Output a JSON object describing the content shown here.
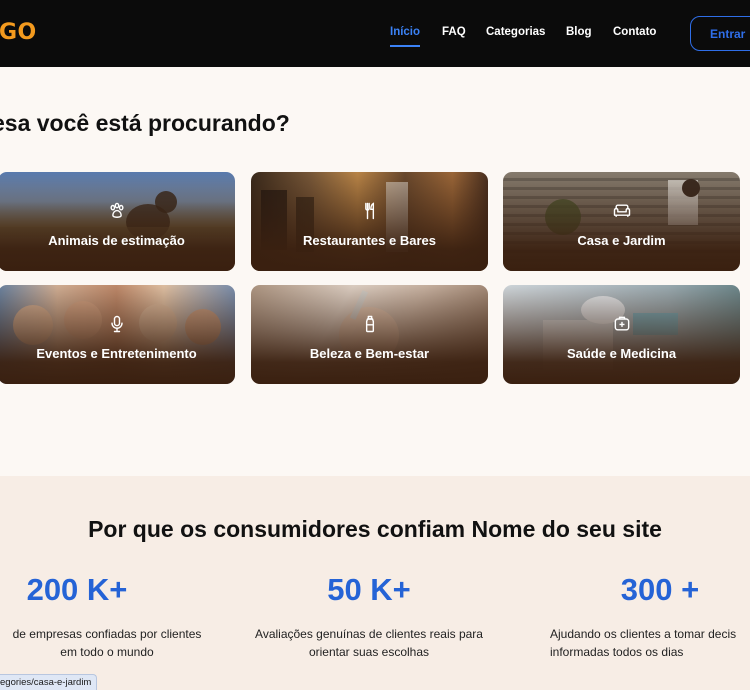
{
  "header": {
    "logo": "GO",
    "nav": [
      {
        "label": "Início",
        "active": true
      },
      {
        "label": "FAQ"
      },
      {
        "label": "Categorias"
      },
      {
        "label": "Blog"
      },
      {
        "label": "Contato"
      }
    ],
    "login_label": "Entrar",
    "accent_color": "#3b82f6",
    "logo_color": "#f39a1e"
  },
  "categories": {
    "title": "esa você está procurando?",
    "items": [
      {
        "label": "Animais de estimação",
        "icon": "paw-icon"
      },
      {
        "label": "Restaurantes e Bares",
        "icon": "fork-knife-icon"
      },
      {
        "label": "Casa e Jardim",
        "icon": "sofa-icon"
      },
      {
        "label": "Eventos e Entretenimento",
        "icon": "microphone-icon"
      },
      {
        "label": "Beleza e Bem-estar",
        "icon": "bottle-icon"
      },
      {
        "label": "Saúde e Medicina",
        "icon": "medical-kit-icon"
      }
    ]
  },
  "trust": {
    "title": "Por que os consumidores confiam Nome do seu site",
    "stats": [
      {
        "number": "200 K+",
        "desc": "de empresas confiadas por clientes\nem todo o mundo"
      },
      {
        "number": "50 K+",
        "desc": "Avaliações genuínas de clientes reais para\norientar suas escolhas"
      },
      {
        "number": "300 +",
        "desc": "Ajudando os clientes a tomar decis\ninformadas todos os dias"
      }
    ]
  },
  "status_bar": {
    "url": "egories/casa-e-jardim"
  }
}
